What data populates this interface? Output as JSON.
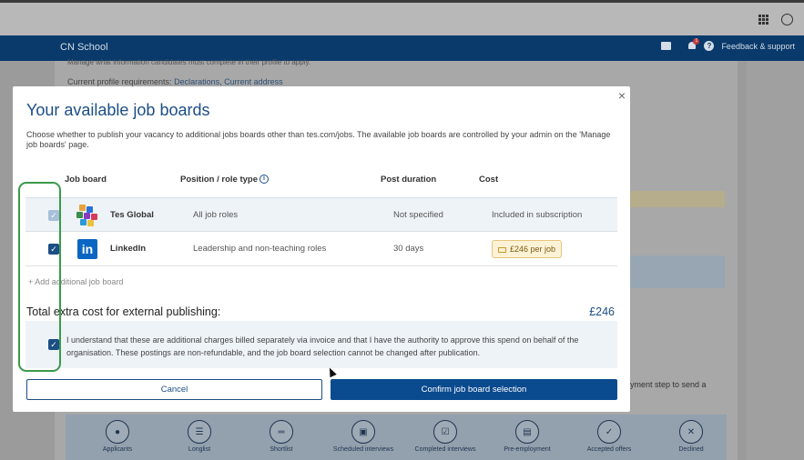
{
  "app": {
    "school_name": "CN School",
    "notification_count": "1",
    "feedback_label": "Feedback & support"
  },
  "background": {
    "text_line_1": "Manage what information candidates must complete in their profile to apply.",
    "requirements_prefix": "Current profile requirements:",
    "requirements_links": "Declarations, Current address",
    "step_text": "yment step to send a"
  },
  "stepper": {
    "steps": [
      {
        "label": "Applicants",
        "icon": "person-icon"
      },
      {
        "label": "Longlist",
        "icon": "list-icon"
      },
      {
        "label": "Shortlist",
        "icon": "shortlist-icon"
      },
      {
        "label": "Scheduled interviews",
        "icon": "calendar-icon"
      },
      {
        "label": "Completed interviews",
        "icon": "calendar-check-icon"
      },
      {
        "label": "Pre-employment",
        "icon": "document-icon"
      },
      {
        "label": "Accepted offers",
        "icon": "document-check-icon"
      },
      {
        "label": "Declined",
        "icon": "x-icon"
      }
    ]
  },
  "modal": {
    "title": "Your available job boards",
    "description": "Choose whether to publish your vacancy to additional jobs boards other than tes.com/jobs. The available job boards are controlled by your admin on the 'Manage job boards' page.",
    "close_symbol": "×",
    "columns": {
      "job_board": "Job board",
      "position": "Position / role type",
      "duration": "Post duration",
      "cost": "Cost"
    },
    "rows": [
      {
        "name": "Tes Global",
        "position": "All job roles",
        "duration": "Not specified",
        "cost": "Included in subscription",
        "checked": true,
        "disabled": true
      },
      {
        "name": "LinkedIn",
        "position": "Leadership and non-teaching roles",
        "duration": "30 days",
        "cost": "£246 per job",
        "checked": true,
        "disabled": false
      }
    ],
    "add_board_label": "+ Add additional job board",
    "total_label": "Total extra cost for external publishing:",
    "total_value": "£246",
    "acknowledgement": "I understand that these are additional charges billed separately via invoice and that I have the authority to approve this spend on behalf of the organisation. These postings are non-refundable, and the job board selection cannot be changed after publication.",
    "cancel_label": "Cancel",
    "confirm_label": "Confirm job board selection"
  },
  "colors": {
    "brand_blue": "#0a3a6b",
    "button_blue": "#0a4a8f",
    "highlight_green": "#3a9a4a"
  }
}
